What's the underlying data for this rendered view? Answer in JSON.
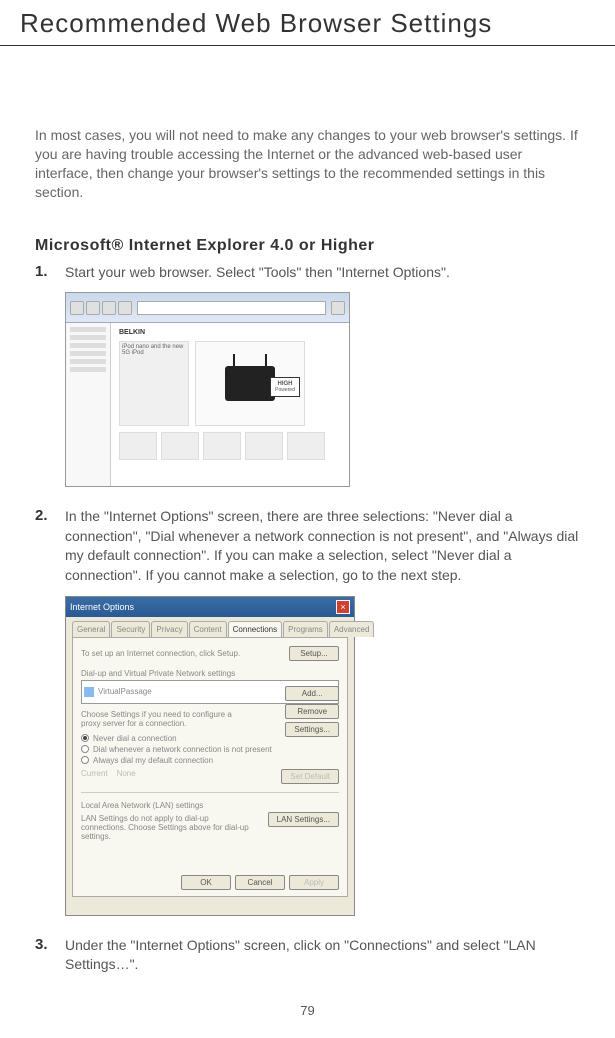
{
  "title": "Recommended Web Browser Settings",
  "intro": "In most cases, you will not need to make any changes to your web browser's settings. If you are having trouble accessing the Internet or the advanced web-based user interface, then change your browser's settings to the recommended settings in this section.",
  "subheading": "Microsoft® Internet Explorer 4.0 or Higher",
  "steps": [
    {
      "num": "1.",
      "text": "Start your web browser. Select \"Tools\" then \"Internet Options\"."
    },
    {
      "num": "2.",
      "text": "In the \"Internet Options\" screen, there are three selections: \"Never dial a connection\", \"Dial whenever a network connection is not present\", and \"Always dial my default connection\". If you can make a selection, select \"Never dial a connection\". If you cannot make a selection, go to the next step."
    },
    {
      "num": "3.",
      "text": "Under the \"Internet Options\" screen, click on \"Connections\" and select \"LAN Settings…\"."
    }
  ],
  "browser_shot": {
    "brand": "BELKIN",
    "ipod_text": "iPod nano and the new 5G iPod",
    "high_label": "HIGH",
    "high_sub": "Powered"
  },
  "dialog": {
    "title": "Internet Options",
    "tabs": [
      "General",
      "Security",
      "Privacy",
      "Content",
      "Connections",
      "Programs",
      "Advanced"
    ],
    "active_tab": "Connections",
    "setup_text": "To set up an Internet connection, click Setup.",
    "setup_btn": "Setup...",
    "group1": "Dial-up and Virtual Private Network settings",
    "conn_item": "VirtualPassage",
    "add_btn": "Add...",
    "remove_btn": "Remove",
    "settings_btn": "Settings...",
    "settings_text": "Choose Settings if you need to configure a proxy server for a connection.",
    "radios": [
      "Never dial a connection",
      "Dial whenever a network connection is not present",
      "Always dial my default connection"
    ],
    "current_label": "Current",
    "current_value": "None",
    "set_default_btn": "Set Default",
    "lan_label": "Local Area Network (LAN) settings",
    "lan_text": "LAN Settings do not apply to dial-up connections. Choose Settings above for dial-up settings.",
    "lan_btn": "LAN Settings...",
    "ok_btn": "OK",
    "cancel_btn": "Cancel",
    "apply_btn": "Apply"
  },
  "page_number": "79"
}
